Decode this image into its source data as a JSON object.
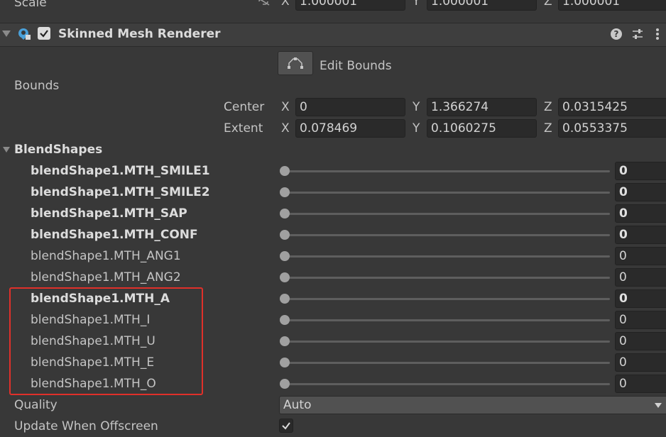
{
  "scale": {
    "label": "Scale",
    "x": "1.000001",
    "y": "1.000001",
    "z": "1.000001"
  },
  "component": {
    "title": "Skinned Mesh Renderer",
    "enabled": true
  },
  "edit_bounds": {
    "label": "Edit Bounds"
  },
  "bounds": {
    "label": "Bounds",
    "center": {
      "label": "Center",
      "x": "0",
      "y": "1.366274",
      "z": "0.0315425"
    },
    "extent": {
      "label": "Extent",
      "x": "0.078469",
      "y": "0.1060275",
      "z": "0.0553375"
    }
  },
  "axes": {
    "x": "X",
    "y": "Y",
    "z": "Z"
  },
  "blendshapes": {
    "label": "BlendShapes",
    "items": [
      {
        "name": "blendShape1.MTH_SMILE1",
        "value": "0",
        "bold": true,
        "slider": 0
      },
      {
        "name": "blendShape1.MTH_SMILE2",
        "value": "0",
        "bold": true,
        "slider": 0
      },
      {
        "name": "blendShape1.MTH_SAP",
        "value": "0",
        "bold": true,
        "slider": 0
      },
      {
        "name": "blendShape1.MTH_CONF",
        "value": "0",
        "bold": true,
        "slider": 0
      },
      {
        "name": "blendShape1.MTH_ANG1",
        "value": "0",
        "bold": false,
        "slider": 0
      },
      {
        "name": "blendShape1.MTH_ANG2",
        "value": "0",
        "bold": false,
        "slider": 0
      },
      {
        "name": "blendShape1.MTH_A",
        "value": "0",
        "bold": true,
        "slider": 0
      },
      {
        "name": "blendShape1.MTH_I",
        "value": "0",
        "bold": false,
        "slider": 0
      },
      {
        "name": "blendShape1.MTH_U",
        "value": "0",
        "bold": false,
        "slider": 0
      },
      {
        "name": "blendShape1.MTH_E",
        "value": "0",
        "bold": false,
        "slider": 0
      },
      {
        "name": "blendShape1.MTH_O",
        "value": "0",
        "bold": false,
        "slider": 0
      }
    ]
  },
  "quality": {
    "label": "Quality",
    "value": "Auto"
  },
  "update_offscreen": {
    "label": "Update When Offscreen",
    "checked": true
  },
  "colors": {
    "highlight_box": "#e0302a",
    "background": "#383838",
    "field": "#2a2a2a"
  }
}
